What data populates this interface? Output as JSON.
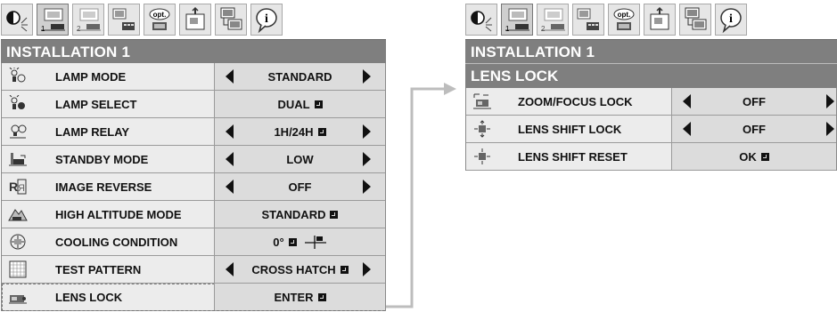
{
  "left_panel": {
    "title": "INSTALLATION 1",
    "rows": [
      {
        "label": "LAMP MODE",
        "value": "STANDARD",
        "arrows": true,
        "enter": false,
        "icon": "lamp-mode-icon"
      },
      {
        "label": "LAMP SELECT",
        "value": "DUAL",
        "arrows": false,
        "enter": true,
        "icon": "lamp-select-icon"
      },
      {
        "label": "LAMP RELAY",
        "value": "1H/24H",
        "arrows": true,
        "enter": true,
        "icon": "lamp-relay-icon"
      },
      {
        "label": "STANDBY MODE",
        "value": "LOW",
        "arrows": true,
        "enter": false,
        "icon": "standby-icon"
      },
      {
        "label": "IMAGE REVERSE",
        "value": "OFF",
        "arrows": true,
        "enter": false,
        "icon": "image-reverse-icon"
      },
      {
        "label": "HIGH ALTITUDE MODE",
        "value": "STANDARD",
        "arrows": false,
        "enter": true,
        "icon": "altitude-icon"
      },
      {
        "label": "COOLING CONDITION",
        "value": "0°",
        "arrows": false,
        "enter": true,
        "icon": "cooling-icon"
      },
      {
        "label": "TEST PATTERN",
        "value": "CROSS HATCH",
        "arrows": true,
        "enter": true,
        "icon": "test-pattern-icon"
      },
      {
        "label": "LENS LOCK",
        "value": "ENTER",
        "arrows": false,
        "enter": true,
        "icon": "lens-lock-icon"
      }
    ]
  },
  "right_panel": {
    "title": "INSTALLATION 1",
    "subtitle": "LENS LOCK",
    "rows": [
      {
        "label": "ZOOM/FOCUS LOCK",
        "value": "OFF",
        "arrows": true,
        "enter": false,
        "icon": "zoom-focus-icon"
      },
      {
        "label": "LENS SHIFT LOCK",
        "value": "OFF",
        "arrows": true,
        "enter": false,
        "icon": "lens-shift-icon"
      },
      {
        "label": "LENS SHIFT RESET",
        "value": "OK",
        "arrows": false,
        "enter": true,
        "icon": "lens-shift-reset-icon"
      }
    ]
  },
  "tabs": [
    {
      "name": "picture-tab",
      "text": ""
    },
    {
      "name": "installation-1-tab",
      "text": "1"
    },
    {
      "name": "installation-2-tab",
      "text": "2"
    },
    {
      "name": "signal-tab",
      "text": ""
    },
    {
      "name": "option-tab",
      "text": "opt."
    },
    {
      "name": "setting-tab",
      "text": ""
    },
    {
      "name": "network-tab",
      "text": ""
    },
    {
      "name": "information-tab",
      "text": "i"
    }
  ]
}
